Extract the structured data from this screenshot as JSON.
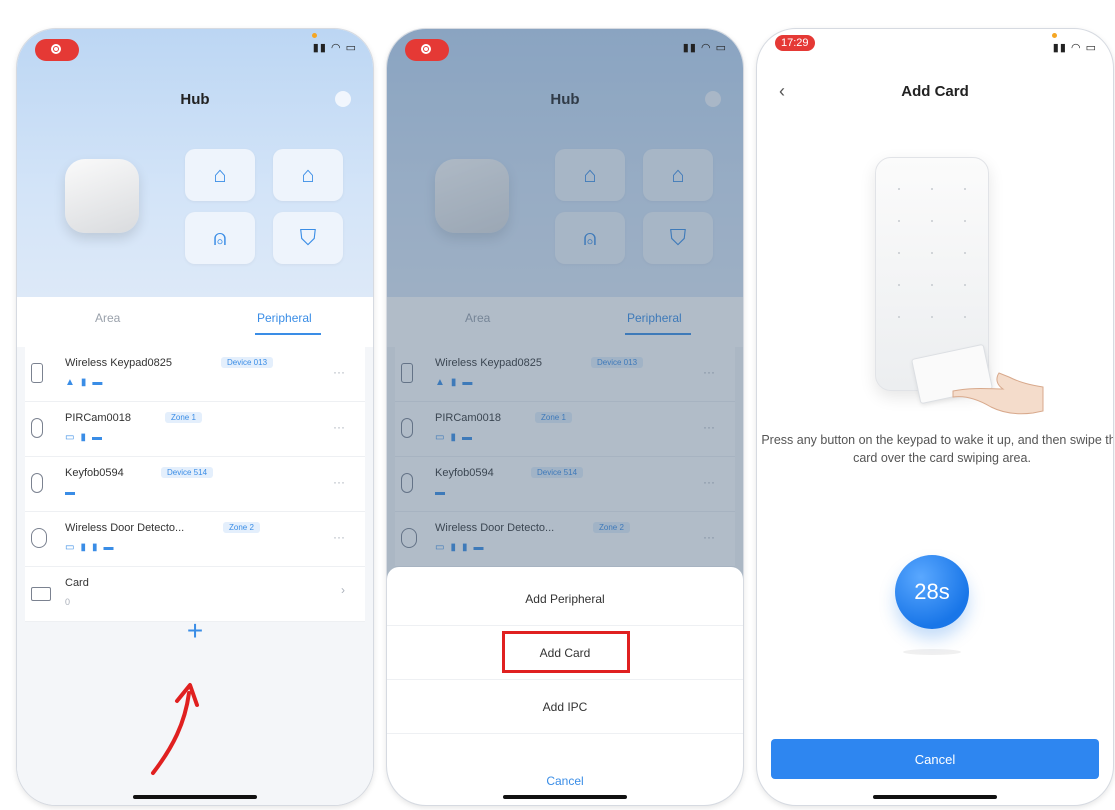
{
  "screen1": {
    "title": "Hub",
    "tabs": [
      "Area",
      "Peripheral"
    ],
    "devices": [
      {
        "name": "Wireless Keypad0825",
        "tag": "Device 013"
      },
      {
        "name": "PIRCam0018",
        "tag": "Zone 1"
      },
      {
        "name": "Keyfob0594",
        "tag": "Device 514"
      },
      {
        "name": "Wireless Door Detecto...",
        "tag": "Zone 2"
      }
    ],
    "card": {
      "label": "Card",
      "count": "0"
    },
    "add": "+"
  },
  "screen2": {
    "title": "Hub",
    "tabs": [
      "Area",
      "Peripheral"
    ],
    "devices": [
      {
        "name": "Wireless Keypad0825",
        "tag": "Device 013"
      },
      {
        "name": "PIRCam0018",
        "tag": "Zone 1"
      },
      {
        "name": "Keyfob0594",
        "tag": "Device 514"
      },
      {
        "name": "Wireless Door Detecto...",
        "tag": "Zone 2"
      }
    ],
    "sheet": {
      "header": "Add Peripheral",
      "add_card": "Add Card",
      "add_ipc": "Add IPC",
      "cancel": "Cancel"
    }
  },
  "screen3": {
    "time": "17:29",
    "title": "Add Card",
    "instruction": "Press any button on the keypad to wake it up, and then swipe the card over the card swiping area.",
    "countdown": "28s",
    "cancel": "Cancel"
  },
  "icons": {
    "mode_buttons": [
      "home-away-icon",
      "home-stay-icon",
      "bell-icon",
      "shield-icon"
    ]
  },
  "colors": {
    "accent": "#3a8de6",
    "highlight": "#e02020",
    "button": "#2e86f0"
  }
}
